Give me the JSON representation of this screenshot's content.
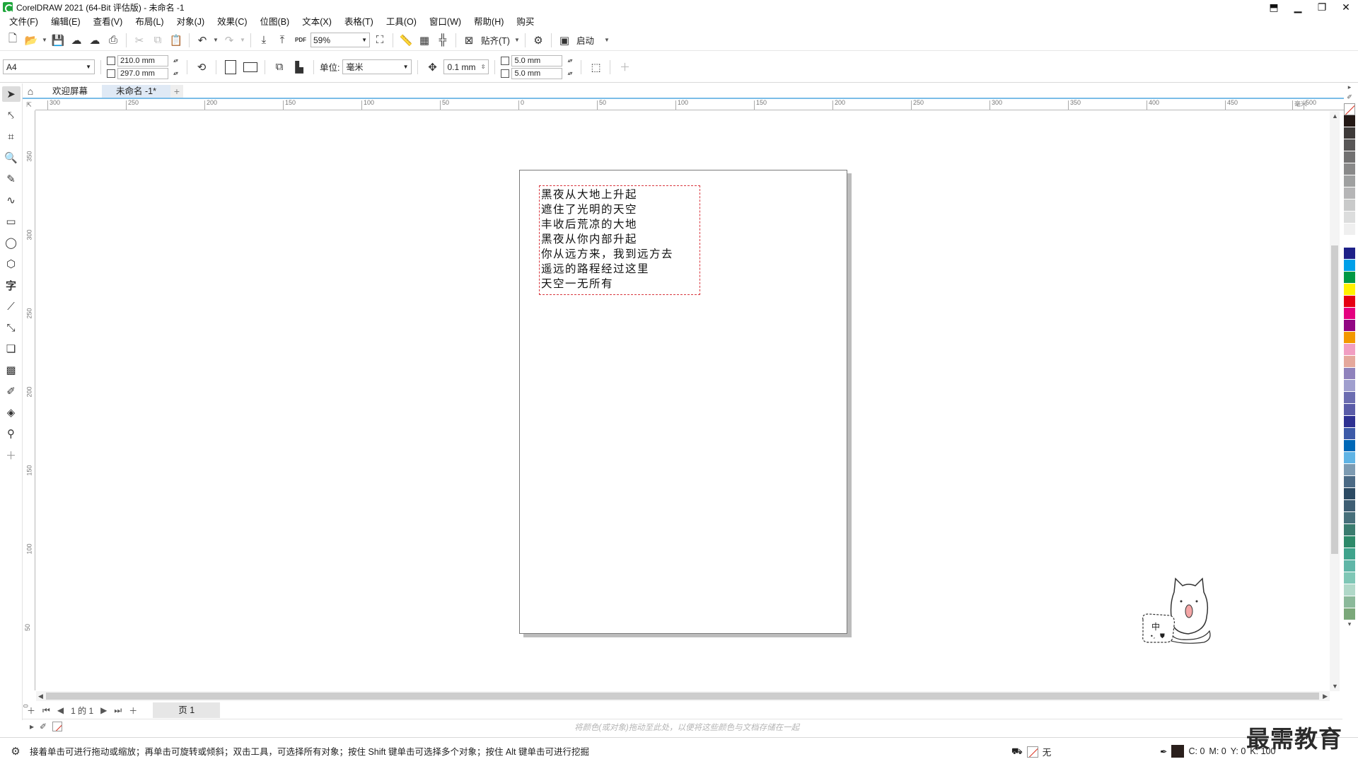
{
  "window": {
    "title": "CorelDRAW 2021 (64-Bit 评估版) - 未命名 -1",
    "controls": [
      "minimize-icon",
      "restore-icon",
      "close-icon"
    ]
  },
  "menu": [
    "文件(F)",
    "编辑(E)",
    "查看(V)",
    "布局(L)",
    "对象(J)",
    "效果(C)",
    "位图(B)",
    "文本(X)",
    "表格(T)",
    "工具(O)",
    "窗口(W)",
    "帮助(H)",
    "购买"
  ],
  "toolbar": {
    "zoom": "59%",
    "pdf_label": "PDF",
    "snap_label": "贴齐(T)",
    "launch_label": "启动"
  },
  "propbar": {
    "page_size": "A4",
    "width": "210.0 mm",
    "height": "297.0 mm",
    "unit_label": "单位:",
    "unit_value": "毫米",
    "nudge": "0.1 mm",
    "dup_x": "5.0 mm",
    "dup_y": "5.0 mm"
  },
  "tabs": {
    "welcome": "欢迎屏幕",
    "document": "未命名 -1*"
  },
  "ruler": {
    "h_unit": "毫米",
    "h_ticks": [
      "300",
      "250",
      "200",
      "150",
      "100",
      "50",
      "0",
      "50",
      "100",
      "150",
      "200",
      "250",
      "300",
      "350",
      "400",
      "450",
      "500"
    ],
    "v_ticks": [
      "350",
      "300",
      "250",
      "200",
      "150",
      "100",
      "50",
      "0"
    ]
  },
  "text_frame": {
    "lines": [
      "黑夜从大地上升起",
      "遮住了光明的天空",
      "丰收后荒凉的大地",
      "黑夜从你内部升起",
      "你从远方来，我到远方去",
      "遥远的路程经过这里",
      "天空一无所有"
    ]
  },
  "page_nav": {
    "current": "1",
    "of_label": "的",
    "total": "1",
    "page_tab": "页 1"
  },
  "doc_palette_hint": "将颜色(或对象)拖动至此处，以便将这些颜色与文档存储在一起",
  "status": {
    "hint": "接着单击可进行拖动或缩放；再单击可旋转或倾斜；双击工具，可选择所有对象；按住 Shift 键单击可选择多个对象；按住 Alt 键单击可进行挖掘",
    "fill_label": "无",
    "cmyk": [
      "C: 0",
      "M: 0",
      "Y: 0",
      "K: 100"
    ]
  },
  "mascot_text": "中",
  "watermark": "最需教育",
  "palette_colors": [
    "#231815",
    "#3e3a39",
    "#595757",
    "#727171",
    "#898989",
    "#9fa0a0",
    "#b5b5b6",
    "#c9caca",
    "#dcdddd",
    "#efefef",
    "#ffffff",
    "#1d2088",
    "#00a0e9",
    "#009944",
    "#fff100",
    "#e60012",
    "#e4007f",
    "#920783",
    "#f39800",
    "#f19ec2",
    "#e5a89c",
    "#8f82bc",
    "#a09fce",
    "#6c6db1",
    "#5a5ca8",
    "#2e3192",
    "#3c5aa8",
    "#0068b7",
    "#60b4e5",
    "#7d9bb2",
    "#4b6a85",
    "#2c4a63",
    "#3e5e73",
    "#47707b",
    "#3a7c6f",
    "#2d8a6a",
    "#3fa38c",
    "#5fb6a7",
    "#7fc7b6",
    "#b0d8c8",
    "#8bb99a",
    "#7ba87a"
  ]
}
